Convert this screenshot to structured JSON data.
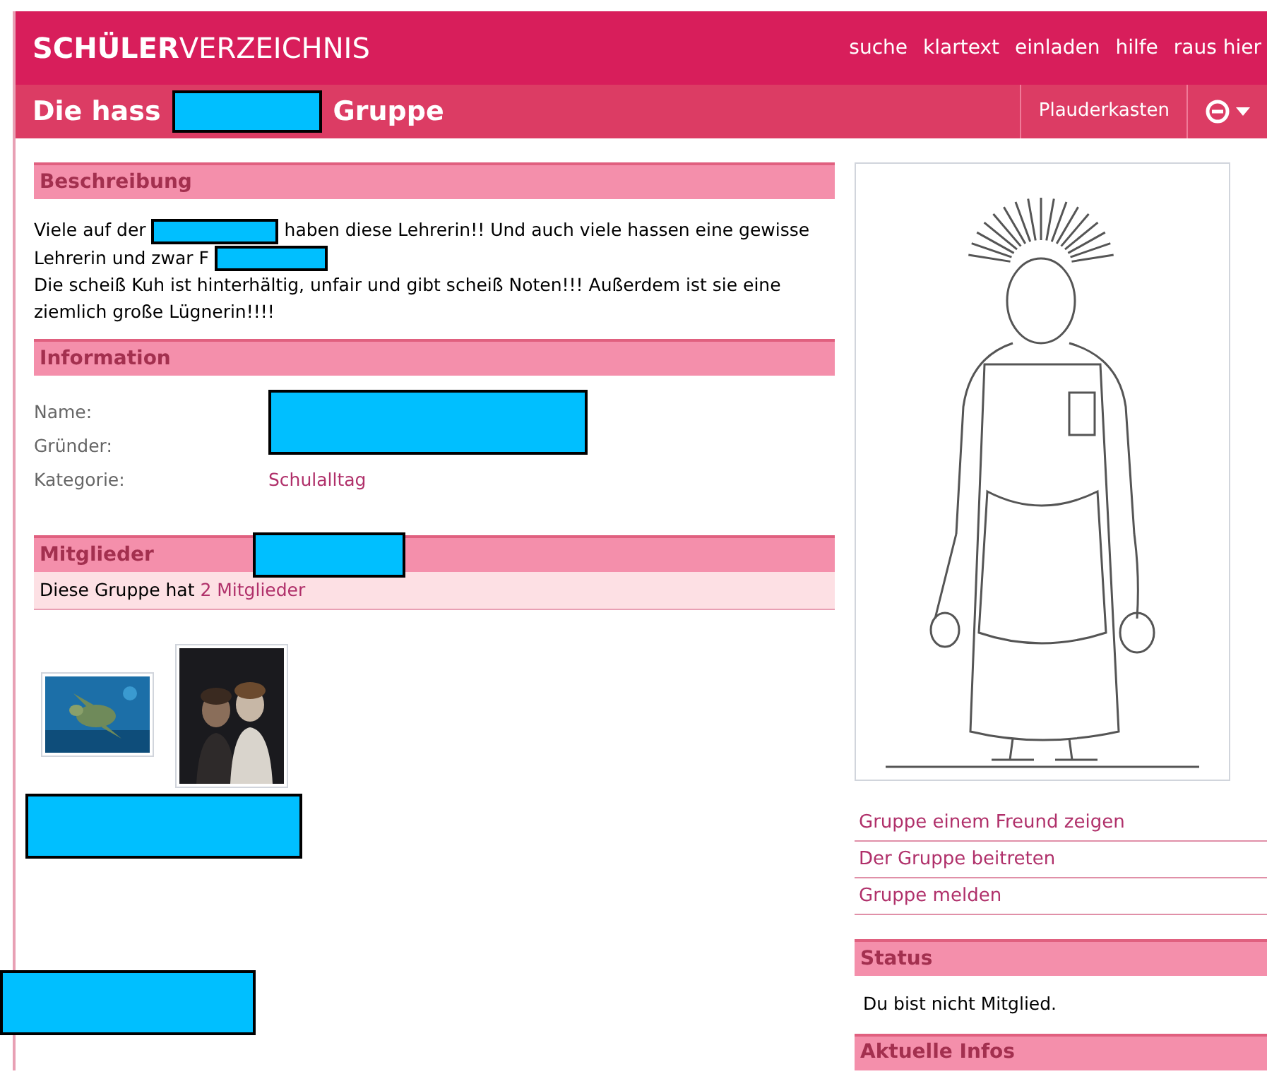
{
  "brand": {
    "bold": "SCHÜLER",
    "light": "VERZEICHNIS"
  },
  "top_nav": [
    "suche",
    "klartext",
    "einladen",
    "hilfe",
    "raus hier"
  ],
  "group_title": {
    "before": "Die hass",
    "after": "Gruppe"
  },
  "group_nav": {
    "chat": "Plauderkasten"
  },
  "description": {
    "heading": "Beschreibung",
    "segments": [
      "Viele auf der",
      "haben diese Lehrerin!! Und auch viele hassen eine gewisse Lehrerin und zwar F"
    ],
    "paragraph": "Die scheiß Kuh ist hinterhältig, unfair und gibt scheiß Noten!!! Außerdem ist sie eine ziemlich große Lügnerin!!!!"
  },
  "information": {
    "heading": "Information",
    "rows": [
      {
        "label": "Name:"
      },
      {
        "label": "Gründer:"
      },
      {
        "label": "Kategorie:",
        "value": "Schulalltag"
      }
    ]
  },
  "members": {
    "heading": "Mitglieder",
    "count_text": "Diese Gruppe hat",
    "count_link": "2 Mitglieder"
  },
  "actions": [
    "Gruppe einem Freund zeigen",
    "Der Gruppe beitreten",
    "Gruppe melden"
  ],
  "status": {
    "heading": "Status",
    "text": "Du bist nicht Mitglied."
  },
  "news": {
    "heading": "Aktuelle Infos"
  }
}
